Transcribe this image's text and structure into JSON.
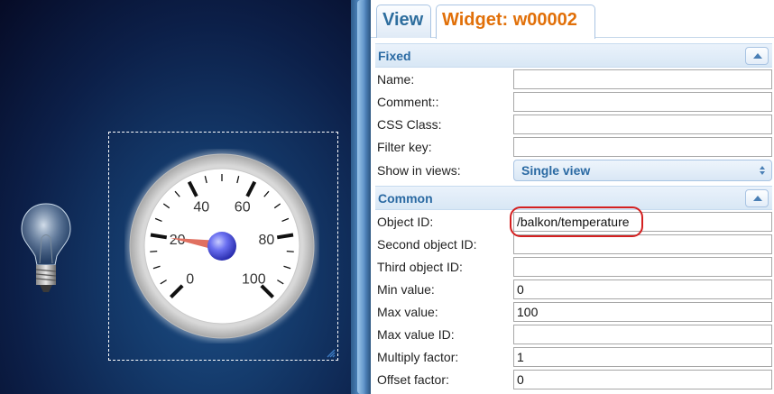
{
  "gauge": {
    "tick_labels": [
      "0",
      "20",
      "40",
      "60",
      "80",
      "100"
    ],
    "value": 20,
    "min": 0,
    "max": 100
  },
  "tabs": {
    "view": "View",
    "widget": "Widget: w00002"
  },
  "sections": {
    "fixed": {
      "title": "Fixed",
      "name_label": "Name:",
      "name_value": "",
      "comment_label": "Comment::",
      "comment_value": "",
      "css_class_label": "CSS Class:",
      "css_class_value": "",
      "filter_key_label": "Filter key:",
      "filter_key_value": "",
      "show_in_views_label": "Show in views:",
      "show_in_views_value": "Single view"
    },
    "common": {
      "title": "Common",
      "object_id_label": "Object ID:",
      "object_id_value": "/balkon/temperature",
      "second_object_id_label": "Second object ID:",
      "second_object_id_value": "",
      "third_object_id_label": "Third object ID:",
      "third_object_id_value": "",
      "min_value_label": "Min value:",
      "min_value_value": "0",
      "max_value_label": "Max value:",
      "max_value_value": "100",
      "max_value_id_label": "Max value ID:",
      "max_value_id_value": "",
      "multiply_factor_label": "Multiply factor:",
      "multiply_factor_value": "1",
      "offset_factor_label": "Offset factor:",
      "offset_factor_value": "0"
    }
  },
  "colors": {
    "tab_view": "#2e6e9e",
    "tab_widget": "#e17009",
    "section_title": "#2b6aa3",
    "highlight": "#d42020",
    "needle": "#e07060"
  }
}
